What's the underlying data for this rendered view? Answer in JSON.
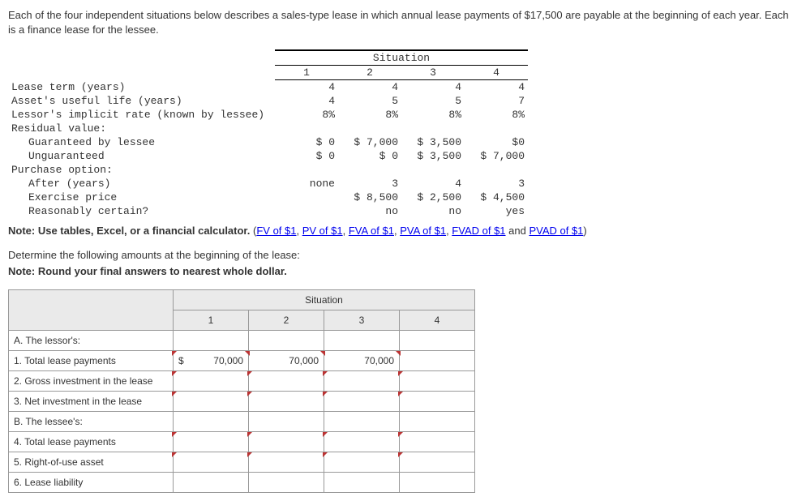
{
  "intro": "Each of the four independent situations below describes a sales-type lease in which annual lease payments of $17,500 are payable at the beginning of each year. Each is a finance lease for the lessee.",
  "situation_header": "Situation",
  "col_headers": [
    "1",
    "2",
    "3",
    "4"
  ],
  "rows": {
    "lease_term": {
      "label": "Lease term (years)",
      "v": [
        "4",
        "4",
        "4",
        "4"
      ]
    },
    "useful_life": {
      "label": "Asset's useful life (years)",
      "v": [
        "4",
        "5",
        "5",
        "7"
      ]
    },
    "implicit_rate": {
      "label": "Lessor's implicit rate (known by lessee)",
      "v": [
        "8%",
        "8%",
        "8%",
        "8%"
      ]
    },
    "residual": {
      "label": "Residual value:"
    },
    "guaranteed": {
      "label": "Guaranteed by lessee",
      "v": [
        "$ 0",
        "$ 7,000",
        "$ 3,500",
        "$0"
      ]
    },
    "unguaranteed": {
      "label": "Unguaranteed",
      "v": [
        "$ 0",
        "$ 0",
        "$ 3,500",
        "$ 7,000"
      ]
    },
    "purchase": {
      "label": "Purchase option:"
    },
    "after": {
      "label": "After (years)",
      "v": [
        "none",
        "3",
        "4",
        "3"
      ]
    },
    "exercise": {
      "label": "Exercise price",
      "v": [
        "",
        "$ 8,500",
        "$ 2,500",
        "$ 4,500"
      ]
    },
    "reasonably": {
      "label": "Reasonably certain?",
      "v": [
        "",
        "no",
        "no",
        "yes"
      ]
    }
  },
  "note_prefix": "Note: Use tables, Excel, or a financial calculator.",
  "links": {
    "fv": "FV of $1",
    "pv": "PV of $1",
    "fva": "FVA of $1",
    "pva": "PVA of $1",
    "fvad": "FVAD of $1",
    "pvad": "PVAD of $1"
  },
  "and_text": " and ",
  "paren_open": " (",
  "paren_close": ")",
  "comma": ", ",
  "instruction1": "Determine the following amounts at the beginning of the lease:",
  "instruction2": "Note: Round your final answers to nearest whole dollar.",
  "answer": {
    "sit_header": "Situation",
    "cols": [
      "1",
      "2",
      "3",
      "4"
    ],
    "sectionA": "A. The lessor's:",
    "r1": {
      "label": "1. Total lease payments",
      "currency": "$",
      "v": [
        "70,000",
        "70,000",
        "70,000",
        ""
      ]
    },
    "r2": {
      "label": "2. Gross investment in the lease"
    },
    "r3": {
      "label": "3. Net investment in the lease"
    },
    "sectionB": "B. The lessee's:",
    "r4": {
      "label": "4. Total lease payments"
    },
    "r5": {
      "label": "5. Right-of-use asset"
    },
    "r6": {
      "label": "6. Lease liability"
    }
  }
}
